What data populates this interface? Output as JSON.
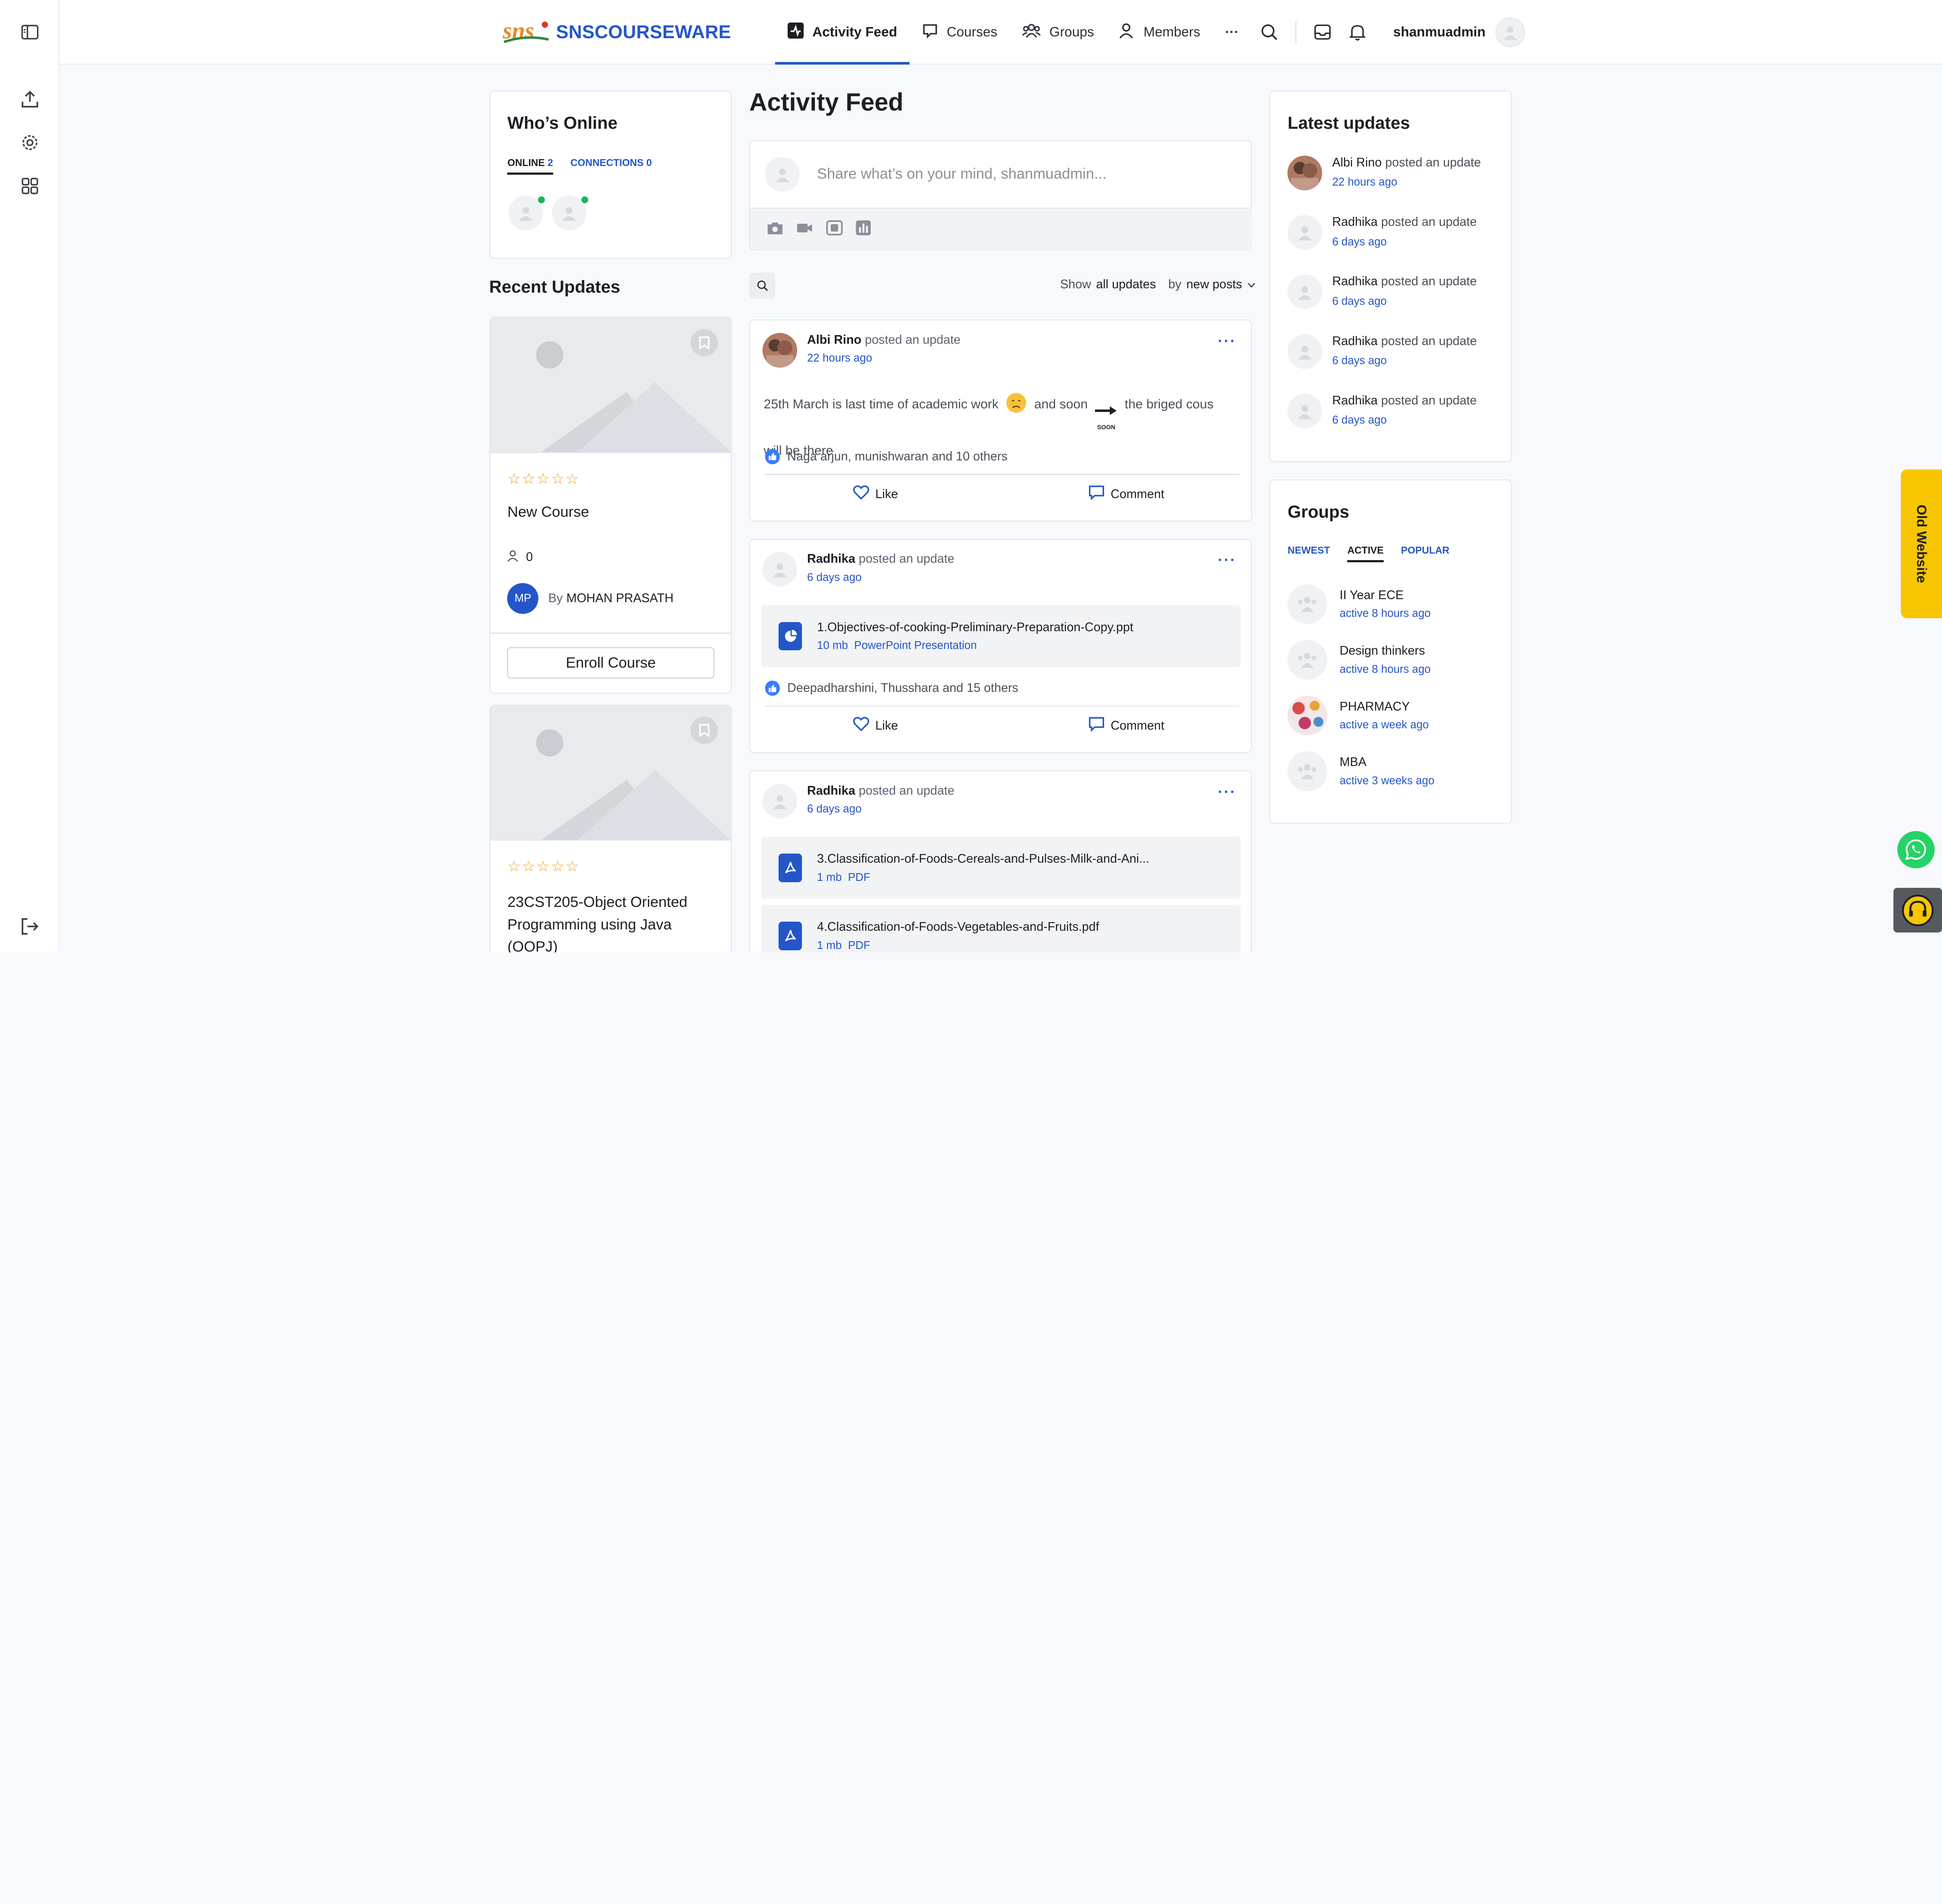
{
  "brand": {
    "name": "SNSCOURSEWARE",
    "mark": "sns"
  },
  "nav": [
    {
      "label": "Activity Feed",
      "icon": "activity-icon",
      "active": true
    },
    {
      "label": "Courses",
      "icon": "courses-icon"
    },
    {
      "label": "Groups",
      "icon": "groups-icon"
    },
    {
      "label": "Members",
      "icon": "members-icon"
    }
  ],
  "header": {
    "username": "shanmuadmin",
    "more": "···"
  },
  "whos_online": {
    "title": "Who’s Online",
    "tab_online": "ONLINE",
    "online_count": "2",
    "tab_connections": "CONNECTIONS",
    "connections_count": "0"
  },
  "recent_updates": {
    "title": "Recent Updates",
    "courses": [
      {
        "stars": "☆☆☆☆☆",
        "title": "New Course",
        "students": "0",
        "instructor_initials": "MP",
        "by": "By",
        "instructor": "MOHAN PRASATH",
        "enroll": "Enroll Course"
      },
      {
        "stars": "☆☆☆☆☆",
        "title": "23CST205-Object Oriented Programming using Java (OOPJ)"
      }
    ]
  },
  "feed": {
    "title": "Activity Feed",
    "composer_placeholder": "Share what’s on your mind, shanmuadmin...",
    "filter_show": "Show",
    "filter_value": "all updates",
    "filter_by": "by",
    "filter_sort": "new posts",
    "like_label": "Like",
    "comment_label": "Comment",
    "posted_text": "posted an update",
    "posts": [
      {
        "author": "Albi Rino",
        "time": "22 hours ago",
        "text_a": "25th March is last time of academic work",
        "text_b": "and soon",
        "soon_label": "SOON",
        "text_c": "the briged cous will be",
        "text_d": "there",
        "likes": "Naga arjun, munishwaran and 10 others"
      },
      {
        "author": "Radhika",
        "time": "6 days ago",
        "file_title": "1.Objectives-of-cooking-Preliminary-Preparation-Copy.ppt",
        "file_size": "10 mb",
        "file_type": "PowerPoint Presentation",
        "likes": "Deepadharshini, Thusshara and 15 others"
      },
      {
        "author": "Radhika",
        "time": "6 days ago",
        "files": [
          {
            "title": "3.Classification-of-Foods-Cereals-and-Pulses-Milk-and-Ani...",
            "size": "1 mb",
            "type": "PDF"
          },
          {
            "title": "4.Classification-of-Foods-Vegetables-and-Fruits.pdf",
            "size": "1 mb",
            "type": "PDF"
          }
        ]
      }
    ]
  },
  "latest_updates": {
    "title": "Latest updates",
    "posted_text": "posted an update",
    "items": [
      {
        "name": "Albi Rino",
        "time": "22 hours ago"
      },
      {
        "name": "Radhika",
        "time": "6 days ago"
      },
      {
        "name": "Radhika",
        "time": "6 days ago"
      },
      {
        "name": "Radhika",
        "time": "6 days ago"
      },
      {
        "name": "Radhika",
        "time": "6 days ago"
      }
    ]
  },
  "groups": {
    "title": "Groups",
    "tabs": [
      "NEWEST",
      "ACTIVE",
      "POPULAR"
    ],
    "items": [
      {
        "name": "II Year ECE",
        "time": "active 8 hours ago"
      },
      {
        "name": "Design thinkers",
        "time": "active 8 hours ago"
      },
      {
        "name": "PHARMACY",
        "time": "active a week ago"
      },
      {
        "name": "MBA",
        "time": "active 3 weeks ago"
      }
    ]
  },
  "old_website": "Old Website",
  "colors": {
    "accent": "#2456c9",
    "online": "#1bb55c",
    "side_tab": "#f7c600",
    "whatsapp": "#25d366"
  }
}
